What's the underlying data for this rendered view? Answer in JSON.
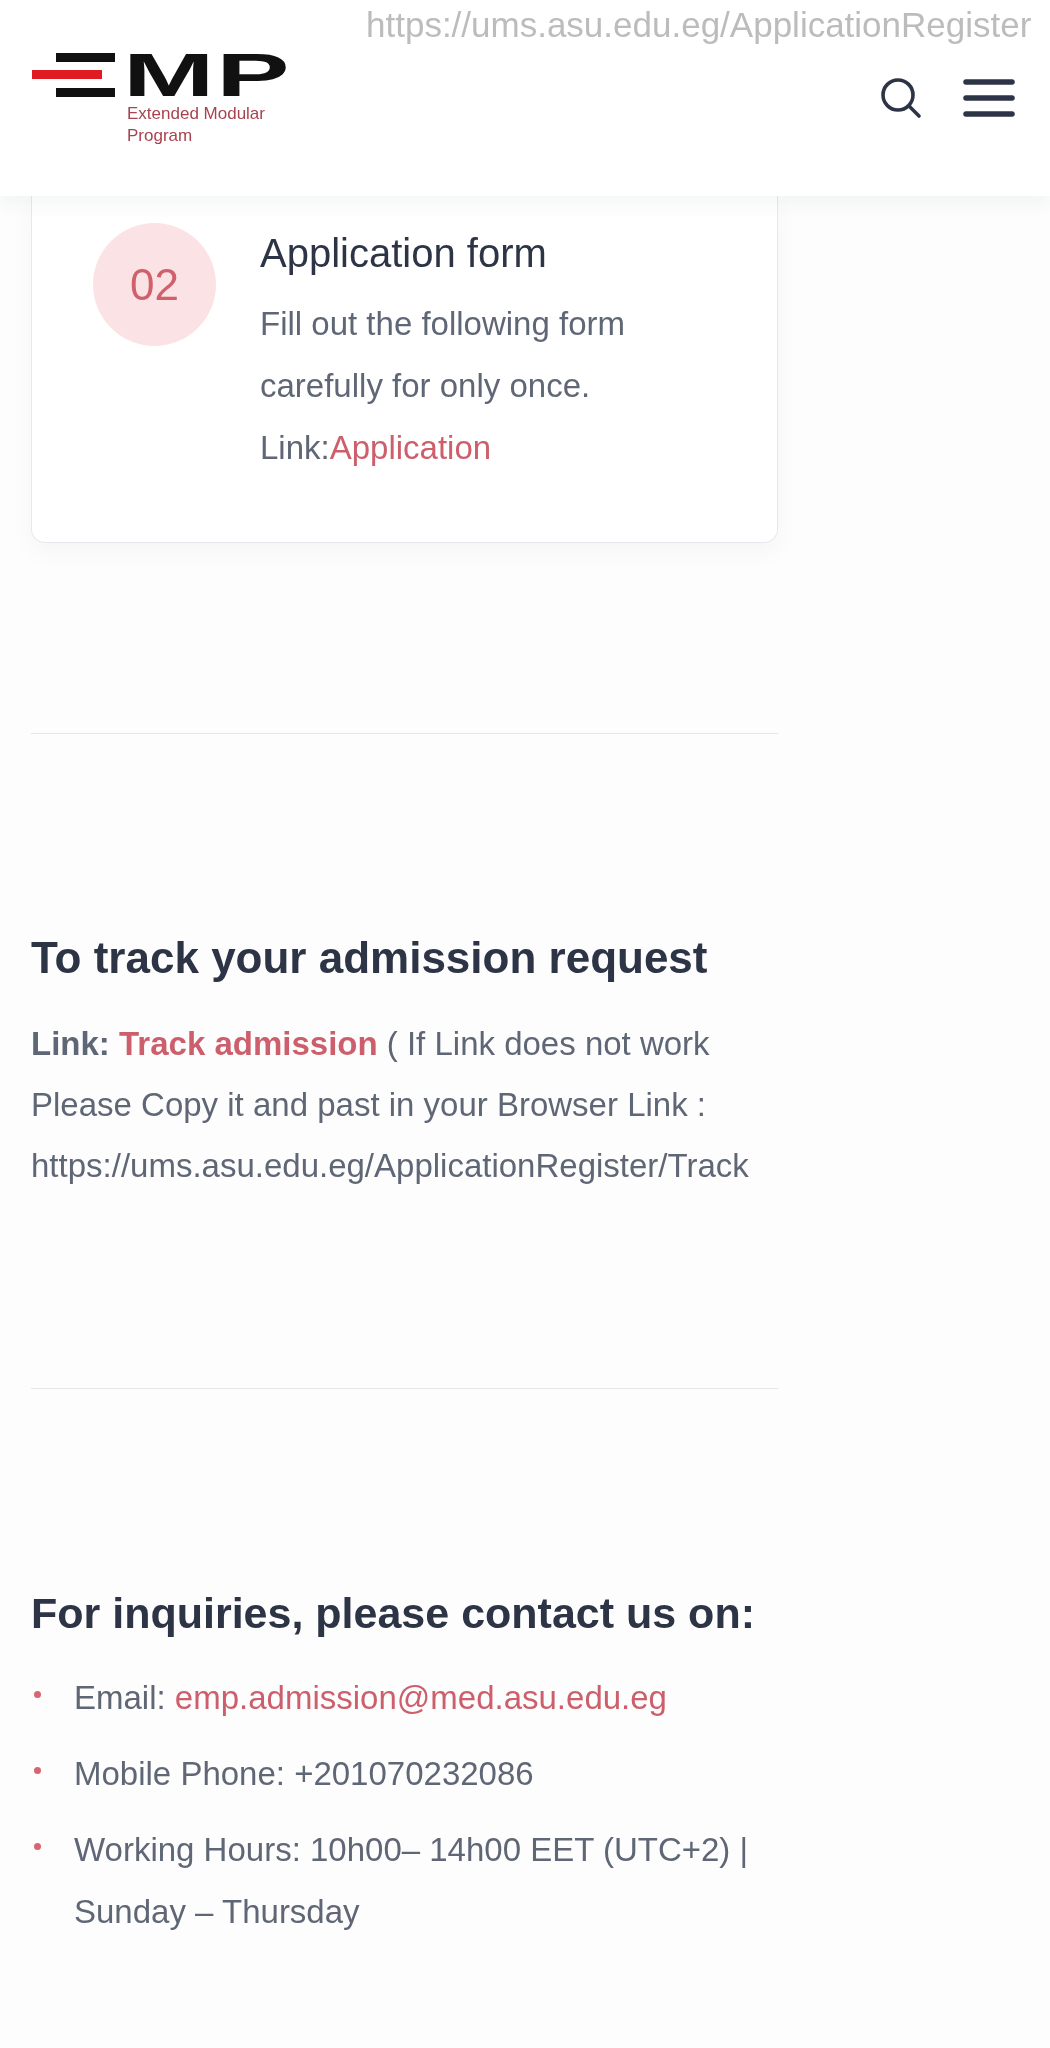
{
  "header": {
    "background_text": "https://ums.asu.edu.eg/ApplicationRegister",
    "logo": {
      "wordmark": "MP",
      "tagline": "Extended Modular Program"
    }
  },
  "step_card": {
    "number": "02",
    "title": "Application form",
    "description": "Fill out the following form carefully for only once.",
    "link_label": "Link:",
    "link_text": "Application"
  },
  "track_section": {
    "heading": "To track your admission request",
    "label": "Link:",
    "link_text": "Track admission",
    "text": "( If Link does not work Please Copy it and past in your Browser Link : https://ums.asu.edu.eg/ApplicationRegister/Track"
  },
  "contact_section": {
    "heading": "For inquiries, please contact us on:",
    "items": [
      {
        "kind": "link",
        "label": "Email:",
        "link_text": "emp.admission@med.asu.edu.eg"
      },
      {
        "kind": "text",
        "text": "Mobile Phone: +201070232086"
      },
      {
        "kind": "text",
        "text": "Working Hours: 10h00– 14h00 EET (UTC+2) | Sunday – Thursday"
      }
    ]
  }
}
